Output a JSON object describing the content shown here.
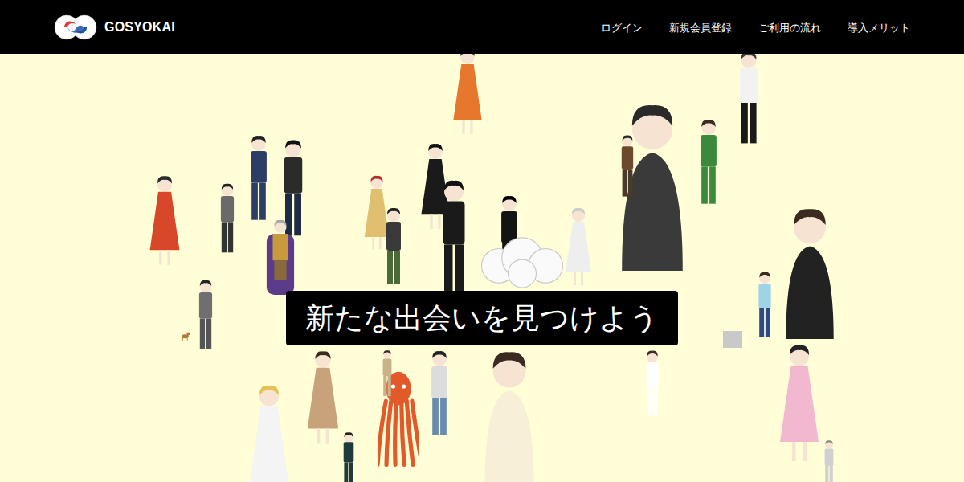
{
  "header": {
    "logo": "GOSYOKAI",
    "nav": [
      "ログイン",
      "新規会員登録",
      "ご利用の流れ",
      "導入メリット"
    ]
  },
  "hero": {
    "caption": "新たな出会いを見つけよう"
  }
}
